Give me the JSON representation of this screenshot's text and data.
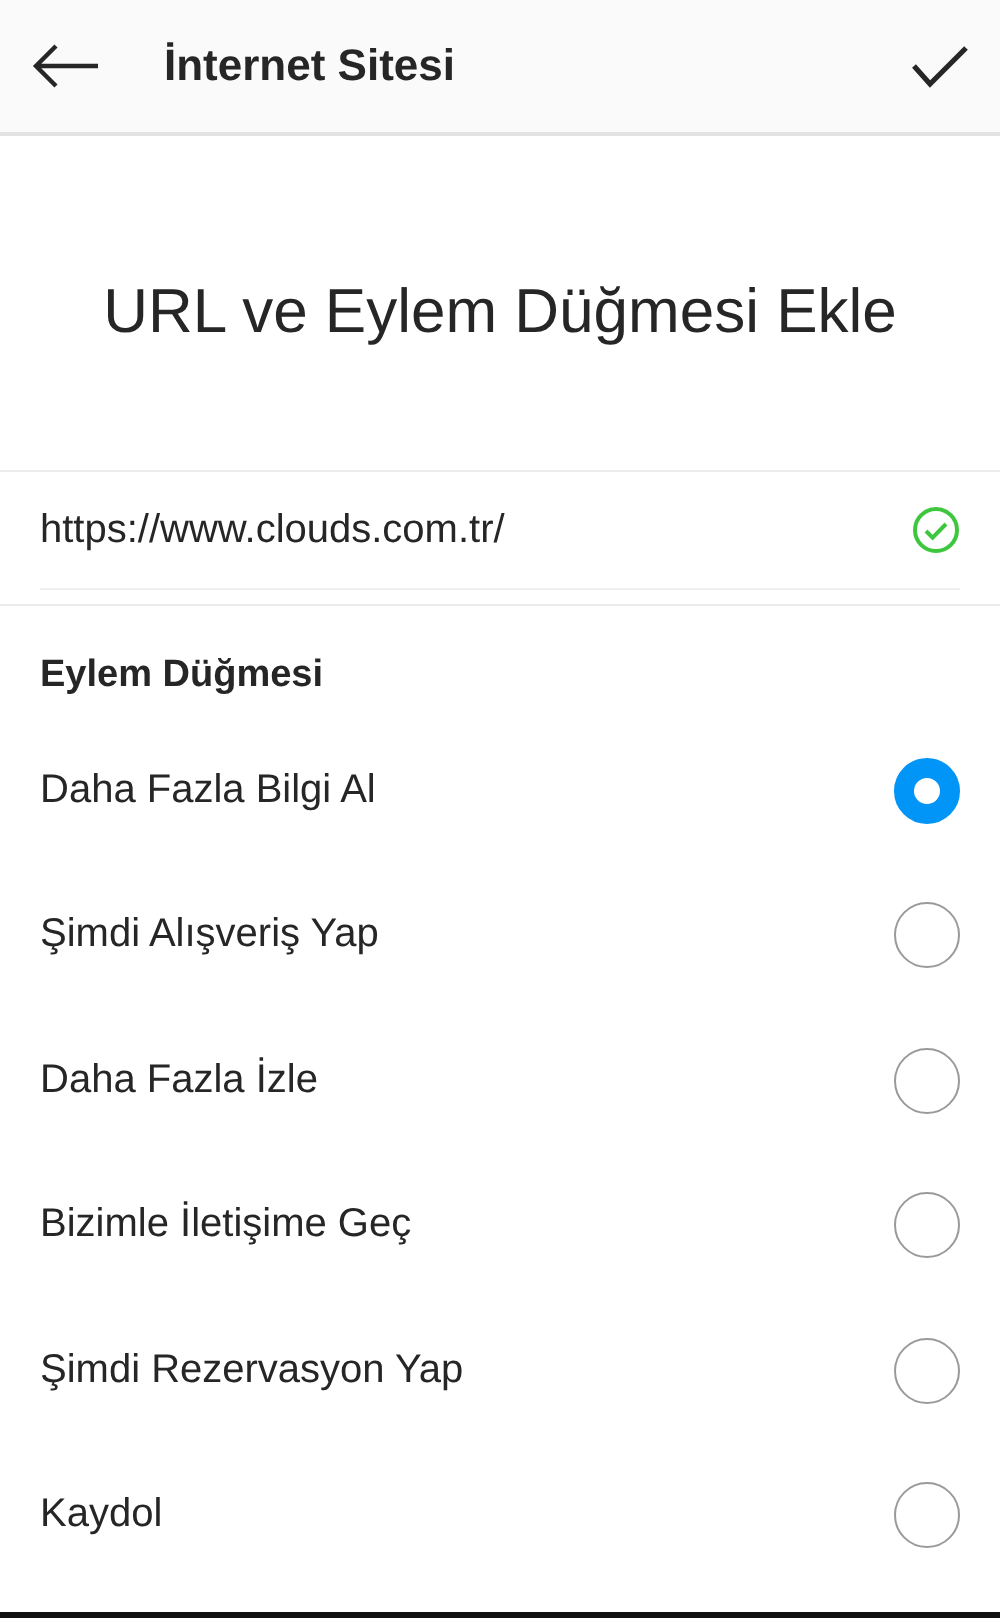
{
  "header": {
    "title": "İnternet Sitesi"
  },
  "heading": "URL ve Eylem Düğmesi Ekle",
  "url_field": {
    "value": "https://www.clouds.com.tr/",
    "valid": true
  },
  "section_title": "Eylem Düğmesi",
  "options": [
    {
      "label": "Daha Fazla Bilgi Al",
      "selected": true
    },
    {
      "label": "Şimdi Alışveriş Yap",
      "selected": false
    },
    {
      "label": "Daha Fazla İzle",
      "selected": false
    },
    {
      "label": "Bizimle İletişime Geç",
      "selected": false
    },
    {
      "label": "Şimdi Rezervasyon Yap",
      "selected": false
    },
    {
      "label": "Kaydol",
      "selected": false
    }
  ]
}
